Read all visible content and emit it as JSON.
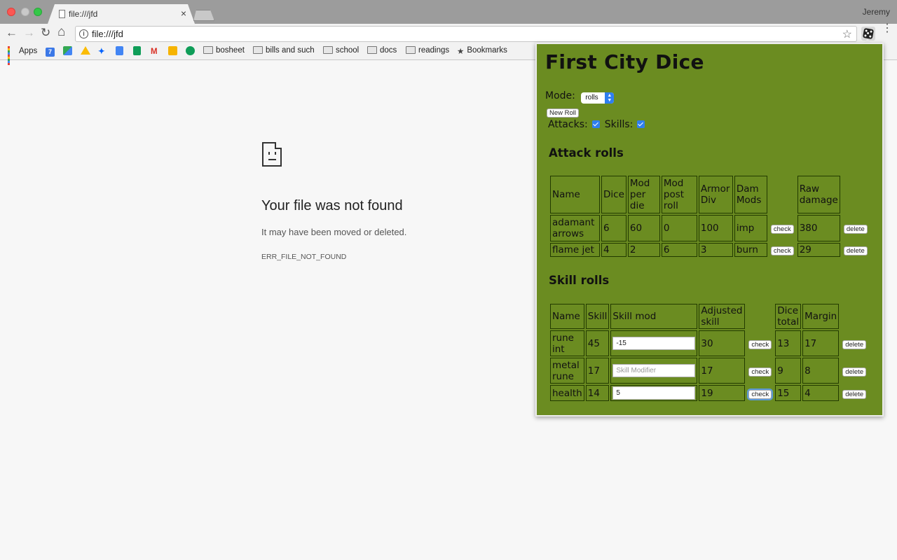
{
  "browser": {
    "tab_title": "file:///jfd",
    "tab_close": "×",
    "profile_name": "Jeremy",
    "url": "file:///jfd",
    "nav": {
      "back": "←",
      "forward": "→",
      "reload": "↻",
      "home": "⌂"
    },
    "star": "☆",
    "menu": "⋮",
    "bookmarks": [
      {
        "label": "Apps",
        "icon": "apps-grid-icon"
      },
      {
        "label": "",
        "icon": "calendar-icon",
        "glyph": "7",
        "color": "#3b78e7"
      },
      {
        "label": "",
        "icon": "maps-icon",
        "color": "#34a853"
      },
      {
        "label": "",
        "icon": "drive-icon",
        "color": "#fbbc05"
      },
      {
        "label": "",
        "icon": "dropbox-icon",
        "color": "#0061fe"
      },
      {
        "label": "",
        "icon": "docs-icon",
        "color": "#4285f4"
      },
      {
        "label": "",
        "icon": "sheets-icon",
        "color": "#0f9d58"
      },
      {
        "label": "",
        "icon": "gmail-icon",
        "glyph": "M",
        "color": "#d93025"
      },
      {
        "label": "",
        "icon": "keep-icon",
        "color": "#f6b400"
      },
      {
        "label": "",
        "icon": "hangouts-icon",
        "color": "#0f9d58"
      },
      {
        "label": "bosheet",
        "icon": "folder-icon"
      },
      {
        "label": "bills and such",
        "icon": "folder-icon"
      },
      {
        "label": "school",
        "icon": "folder-icon"
      },
      {
        "label": "docs",
        "icon": "folder-icon"
      },
      {
        "label": "readings",
        "icon": "folder-icon"
      },
      {
        "label": "Bookmarks",
        "icon": "star-icon",
        "glyph": "★"
      }
    ]
  },
  "error_page": {
    "title": "Your file was not found",
    "subtitle": "It may have been moved or deleted.",
    "code": "ERR_FILE_NOT_FOUND"
  },
  "popup": {
    "title": "First City Dice",
    "mode_label": "Mode:",
    "mode_value": "rolls",
    "new_roll_label": "New Roll",
    "attacks_label": "Attacks:",
    "attacks_checked": true,
    "skills_label": "Skills:",
    "skills_checked": true,
    "attack_section_title": "Attack rolls",
    "attack_headers": [
      "Name",
      "Dice",
      "Mod per die",
      "Mod post roll",
      "Armor Div",
      "Dam Mods",
      "Raw damage"
    ],
    "attack_rows": [
      {
        "name": "adamant arrows",
        "dice": "6",
        "mod_per_die": "60",
        "mod_post_roll": "0",
        "armor_div": "100",
        "dam_mods": "imp",
        "raw_damage": "380"
      },
      {
        "name": "flame jet",
        "dice": "4",
        "mod_per_die": "2",
        "mod_post_roll": "6",
        "armor_div": "3",
        "dam_mods": "burn",
        "raw_damage": "29"
      }
    ],
    "skill_section_title": "Skill rolls",
    "skill_headers": [
      "Name",
      "Skill",
      "Skill mod",
      "Adjusted skill",
      "Dice total",
      "Margin"
    ],
    "skill_rows": [
      {
        "name": "rune int",
        "skill": "45",
        "skill_mod": "-15",
        "adjusted": "30",
        "dice_total": "13",
        "margin": "17"
      },
      {
        "name": "metal rune",
        "skill": "17",
        "skill_mod": "",
        "adjusted": "17",
        "dice_total": "9",
        "margin": "8"
      },
      {
        "name": "health",
        "skill": "14",
        "skill_mod": "5",
        "adjusted": "19",
        "dice_total": "15",
        "margin": "4"
      }
    ],
    "skill_mod_placeholder": "Skill Modifier",
    "check_label": "check",
    "delete_label": "delete",
    "background_color": "#6b8c21"
  }
}
